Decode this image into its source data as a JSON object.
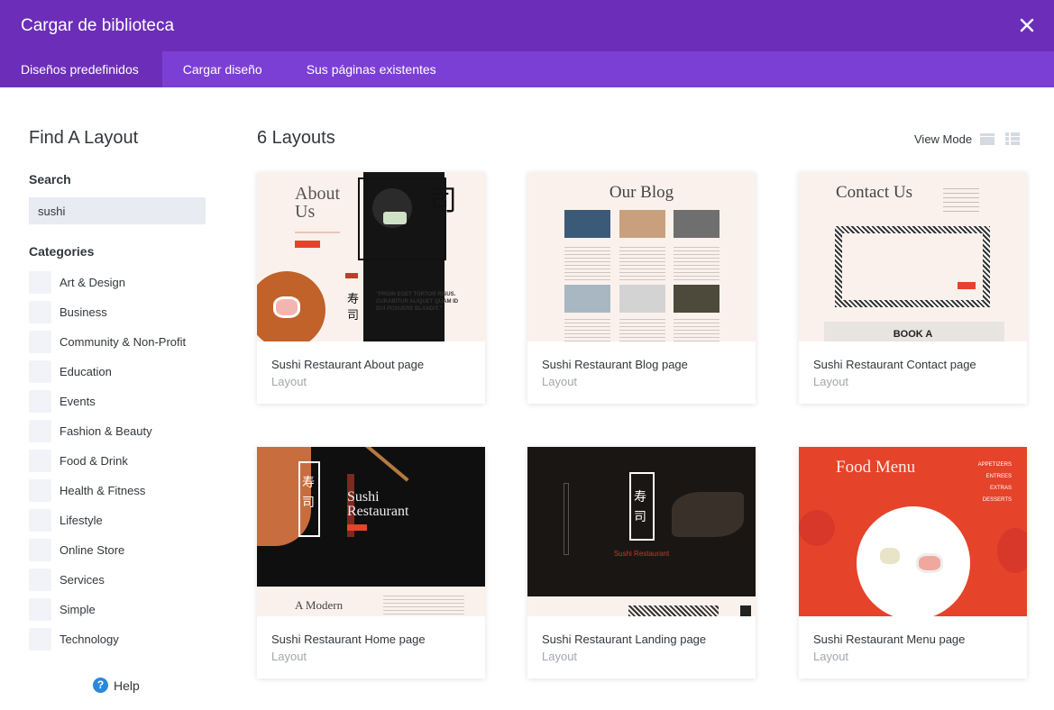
{
  "header": {
    "title": "Cargar de biblioteca"
  },
  "tabs": [
    {
      "label": "Diseños predefinidos"
    },
    {
      "label": "Cargar diseño"
    },
    {
      "label": "Sus páginas existentes"
    }
  ],
  "sidebar": {
    "title": "Find A Layout",
    "search_label": "Search",
    "search_value": "sushi",
    "categories_label": "Categories",
    "categories": [
      "Art & Design",
      "Business",
      "Community & Non-Profit",
      "Education",
      "Events",
      "Fashion & Beauty",
      "Food & Drink",
      "Health & Fitness",
      "Lifestyle",
      "Online Store",
      "Services",
      "Simple",
      "Technology"
    ],
    "help_label": "Help"
  },
  "main": {
    "count_label": "6 Layouts",
    "view_mode_label": "View Mode",
    "layouts": [
      {
        "name": "Sushi Restaurant About page",
        "type": "Layout",
        "thumb_heading": "About Us",
        "thumb_quote": "\"PROIN EGET TORTOR RISUS. CURABITUR ALIQUET QUAM ID DUI POSUERE BLANDIT.\""
      },
      {
        "name": "Sushi Restaurant Blog page",
        "type": "Layout",
        "thumb_heading": "Our Blog"
      },
      {
        "name": "Sushi Restaurant Contact page",
        "type": "Layout",
        "thumb_heading": "Contact Us",
        "thumb_footer": "BOOK A"
      },
      {
        "name": "Sushi Restaurant Home page",
        "type": "Layout",
        "thumb_heading": "Sushi Restaurant",
        "thumb_sub": "A Modern"
      },
      {
        "name": "Sushi Restaurant Landing page",
        "type": "Layout",
        "thumb_heading": "Sushi Restaurant"
      },
      {
        "name": "Sushi Restaurant Menu page",
        "type": "Layout",
        "thumb_heading": "Food Menu",
        "thumb_menu": [
          "APPETIZERS",
          "ENTREES",
          "EXTRAS",
          "DESSERTS"
        ]
      }
    ]
  },
  "colors": {
    "header": "#6c2eb9",
    "tabs": "#7b3fd6",
    "accent_red": "#e5432a",
    "help_blue": "#2b87da"
  },
  "icons": [
    "close-icon",
    "help-icon",
    "grid-view-icon",
    "list-view-icon"
  ]
}
